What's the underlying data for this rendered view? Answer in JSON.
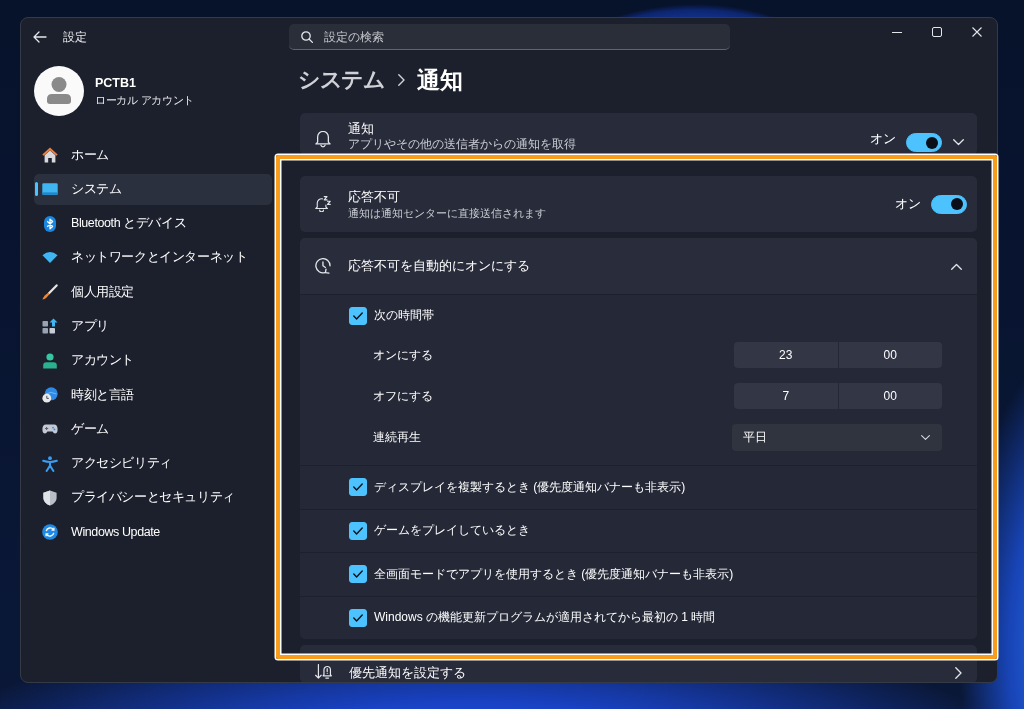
{
  "window": {
    "title": "設定"
  },
  "search": {
    "placeholder": "設定の検索"
  },
  "account": {
    "name": "PCTB1",
    "type": "ローカル アカウント"
  },
  "sidebar": {
    "items": [
      {
        "label": "ホーム",
        "selected": false
      },
      {
        "label": "システム",
        "selected": true
      },
      {
        "label": "Bluetooth とデバイス",
        "selected": false
      },
      {
        "label": "ネットワークとインターネット",
        "selected": false
      },
      {
        "label": "個人用設定",
        "selected": false
      },
      {
        "label": "アプリ",
        "selected": false
      },
      {
        "label": "アカウント",
        "selected": false
      },
      {
        "label": "時刻と言語",
        "selected": false
      },
      {
        "label": "ゲーム",
        "selected": false
      },
      {
        "label": "アクセシビリティ",
        "selected": false
      },
      {
        "label": "プライバシーとセキュリティ",
        "selected": false
      },
      {
        "label": "Windows Update",
        "selected": false
      }
    ]
  },
  "breadcrumb": {
    "parent": "システム",
    "current": "通知"
  },
  "notifications": {
    "title": "通知",
    "description": "アプリやその他の送信者からの通知を取得",
    "toggle_label": "オン",
    "on": true,
    "expanded": false
  },
  "do_not_disturb": {
    "title": "応答不可",
    "description": "通知は通知センターに直接送信されます",
    "toggle_label": "オン",
    "on": true
  },
  "auto_do_not_disturb": {
    "title": "応答不可を自動的にオンにする",
    "expanded": true,
    "schedule": {
      "label": "次の時間帯",
      "checked": true,
      "rows": [
        {
          "kind": "time",
          "label": "オンにする",
          "hour": "23",
          "minute": "00"
        },
        {
          "kind": "time",
          "label": "オフにする",
          "hour": "7",
          "minute": "00"
        },
        {
          "kind": "dropdown",
          "label": "連続再生",
          "value": "平日"
        }
      ]
    },
    "conditions": [
      {
        "label": "ディスプレイを複製するとき (優先度通知バナーも非表示)",
        "checked": true
      },
      {
        "label": "ゲームをプレイしているとき",
        "checked": true
      },
      {
        "label": "全画面モードでアプリを使用するとき (優先度通知バナーも非表示)",
        "checked": true
      },
      {
        "label": "Windows の機能更新プログラムが適用されてから最初の 1 時間",
        "checked": true
      }
    ]
  },
  "priority_notifications": {
    "title": "優先通知を設定する"
  }
}
